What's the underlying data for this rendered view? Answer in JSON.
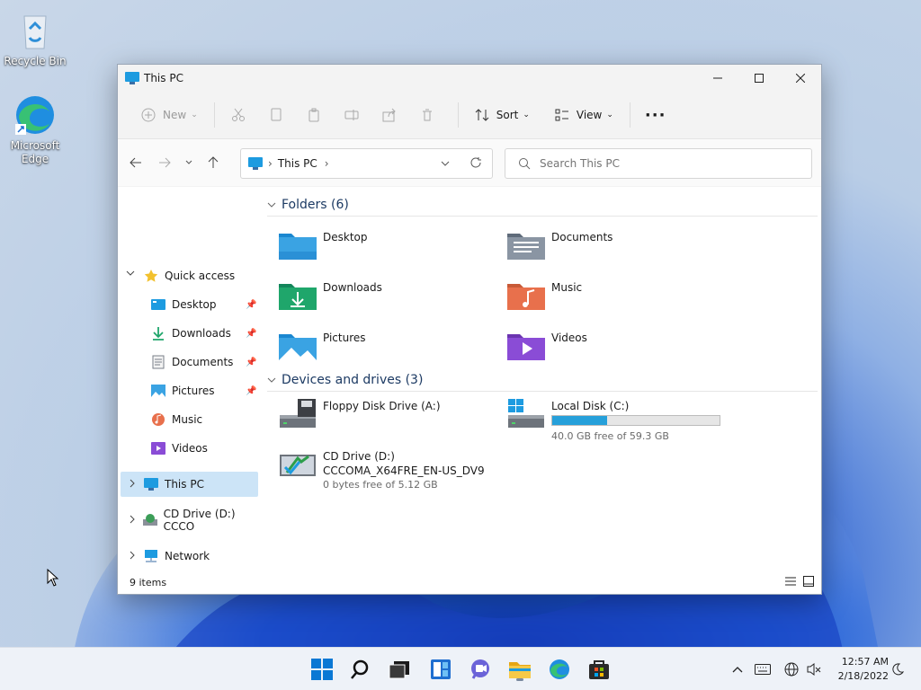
{
  "desktop": {
    "icons": [
      {
        "label": "Recycle Bin"
      },
      {
        "label": "Microsoft Edge"
      }
    ]
  },
  "window": {
    "title": "This PC",
    "toolbar": {
      "new_label": "New",
      "sort_label": "Sort",
      "view_label": "View"
    },
    "address": {
      "location": "This PC"
    },
    "search": {
      "placeholder": "Search This PC"
    },
    "sidebar": {
      "quick_access": "Quick access",
      "pinned": [
        {
          "label": "Desktop"
        },
        {
          "label": "Downloads"
        },
        {
          "label": "Documents"
        },
        {
          "label": "Pictures"
        },
        {
          "label": "Music"
        },
        {
          "label": "Videos"
        }
      ],
      "this_pc": "This PC",
      "cd_drive": "CD Drive (D:) CCCO",
      "network": "Network"
    },
    "content": {
      "folders_header": "Folders (6)",
      "folders": [
        {
          "label": "Desktop"
        },
        {
          "label": "Documents"
        },
        {
          "label": "Downloads"
        },
        {
          "label": "Music"
        },
        {
          "label": "Pictures"
        },
        {
          "label": "Videos"
        }
      ],
      "devices_header": "Devices and drives (3)",
      "floppy": {
        "label": "Floppy Disk Drive (A:)"
      },
      "local_disk": {
        "label": "Local Disk (C:)",
        "free": "40.0 GB free of 59.3 GB",
        "used_fraction": 0.326
      },
      "cd": {
        "label": "CD Drive (D:)",
        "volume": "CCCOMA_X64FRE_EN-US_DV9",
        "free": "0 bytes free of 5.12 GB"
      }
    },
    "status": {
      "items": "9 items"
    }
  },
  "taskbar": {
    "time": "12:57 AM",
    "date": "2/18/2022"
  },
  "colors": {
    "accent": "#26a0da",
    "selected": "#cce4f7",
    "folder_blue": "#3aa3e3",
    "folder_teal": "#1fa66b",
    "folder_music": "#e8704c",
    "folder_video": "#8a4cd6"
  }
}
